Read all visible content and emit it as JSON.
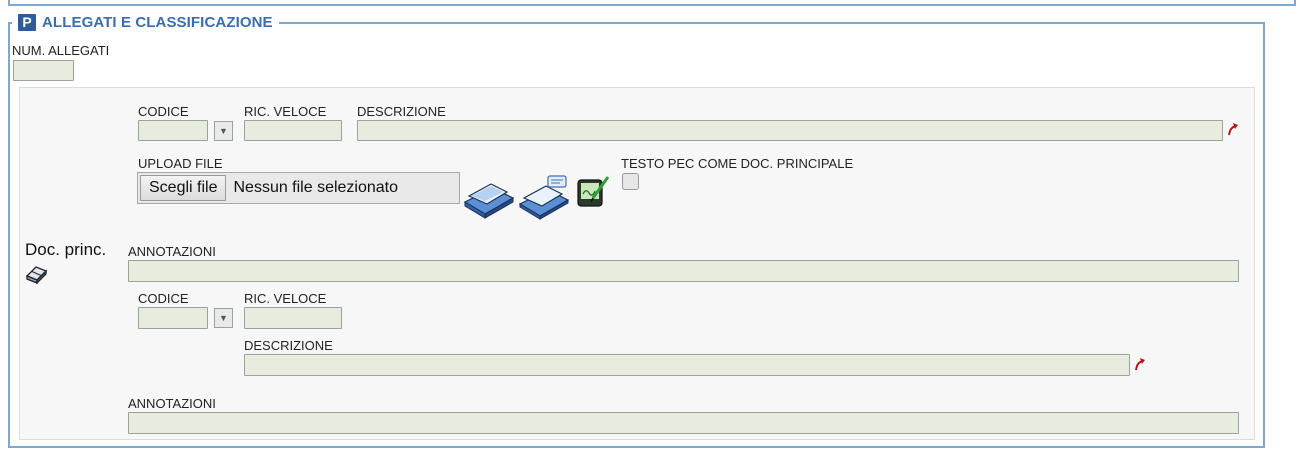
{
  "section": {
    "badge": "P",
    "title": "ALLEGATI E CLASSIFICAZIONE",
    "num_allegati_label": "NUM. ALLEGATI",
    "num_allegati_value": ""
  },
  "doc_principale": {
    "label": "Doc. princ.",
    "codice_label": "CODICE",
    "codice_value": "",
    "ric_veloce_label": "RIC. VELOCE",
    "ric_veloce_value": "",
    "descrizione_label": "DESCRIZIONE",
    "descrizione_value": "",
    "upload_label": "UPLOAD FILE",
    "upload_button": "Scegli file",
    "upload_status": "Nessun file selezionato",
    "testo_pec_label": "TESTO PEC COME DOC. PRINCIPALE",
    "annotazioni_label": "ANNOTAZIONI",
    "annotazioni_value": ""
  },
  "classificazione": {
    "codice_label": "CODICE",
    "codice_value": "",
    "ric_veloce_label": "RIC. VELOCE",
    "ric_veloce_value": "",
    "descrizione_label": "DESCRIZIONE",
    "descrizione_value": "",
    "annotazioni_label": "ANNOTAZIONI",
    "annotazioni_value": ""
  },
  "icons": {
    "scanner": "scanner-icon",
    "scanner_settings": "scanner-settings-icon",
    "signature": "signature-pad-icon",
    "eraser": "eraser-icon",
    "open_link": "open-link-icon"
  },
  "colors": {
    "frame": "#7fa7d3",
    "legend_title": "#3a6db0",
    "badge": "#2f5c98",
    "input_bg": "#e8ecdf",
    "link_arrow": "#b01818"
  }
}
